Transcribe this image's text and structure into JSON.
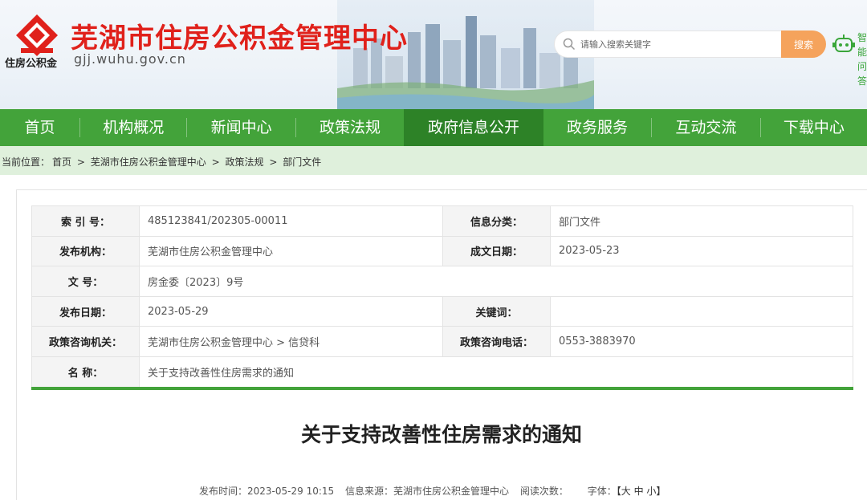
{
  "header": {
    "site_title": "芜湖市住房公积金管理中心",
    "site_url": "gjj.wuhu.gov.cn",
    "logo_caption": "住房公积金",
    "search_placeholder": "请输入搜索关键字",
    "search_button": "搜索",
    "assistant_label": "智能问答"
  },
  "nav": {
    "items": [
      {
        "label": "首页",
        "width": 101
      },
      {
        "label": "机构概况",
        "width": 135
      },
      {
        "label": "新闻中心",
        "width": 137
      },
      {
        "label": "政策法规",
        "width": 137
      },
      {
        "label": "政府信息公开",
        "width": 177,
        "active": true
      },
      {
        "label": "政务服务",
        "width": 137
      },
      {
        "label": "互动交流",
        "width": 137
      },
      {
        "label": "下载中心",
        "width": 135
      }
    ]
  },
  "breadcrumb": {
    "prefix": "当前位置：",
    "items": [
      "首页",
      "芜湖市住房公积金管理中心",
      "政策法规",
      "部门文件"
    ],
    "separator": ">"
  },
  "info": {
    "index_label": "索 引 号：",
    "index_value": "485123841/202305-00011",
    "category_label": "信息分类：",
    "category_value": "部门文件",
    "publisher_label": "发布机构：",
    "publisher_value": "芜湖市住房公积金管理中心",
    "created_label": "成文日期：",
    "created_value": "2023-05-23",
    "docno_label": "文 号：",
    "docno_value": "房金委〔2023〕9号",
    "pubdate_label": "发布日期：",
    "pubdate_value": "2023-05-29",
    "keywords_label": "关键词：",
    "keywords_value": "",
    "consult_org_label": "政策咨询机关：",
    "consult_org_value": "芜湖市住房公积金管理中心 > 信贷科",
    "consult_phone_label": "政策咨询电话：",
    "consult_phone_value": "0553-3883970",
    "name_label": "名 称：",
    "name_value": "关于支持改善性住房需求的通知"
  },
  "article": {
    "title": "关于支持改善性住房需求的通知",
    "time_label": "发布时间：",
    "time_value": "2023-05-29 10:15",
    "source_label": "信息来源：",
    "source_value": "芜湖市住房公积金管理中心",
    "views_label": "阅读次数：",
    "font_label": "字体：",
    "font_open": "【",
    "font_large": "大",
    "font_medium": "中",
    "font_small": "小",
    "font_close": "】"
  },
  "colors": {
    "brand_red": "#e0211b",
    "nav_green": "#43a33a",
    "nav_active": "#2d8227",
    "breadcrumb_bg": "#dff0dc",
    "search_button": "#f5a35c"
  }
}
